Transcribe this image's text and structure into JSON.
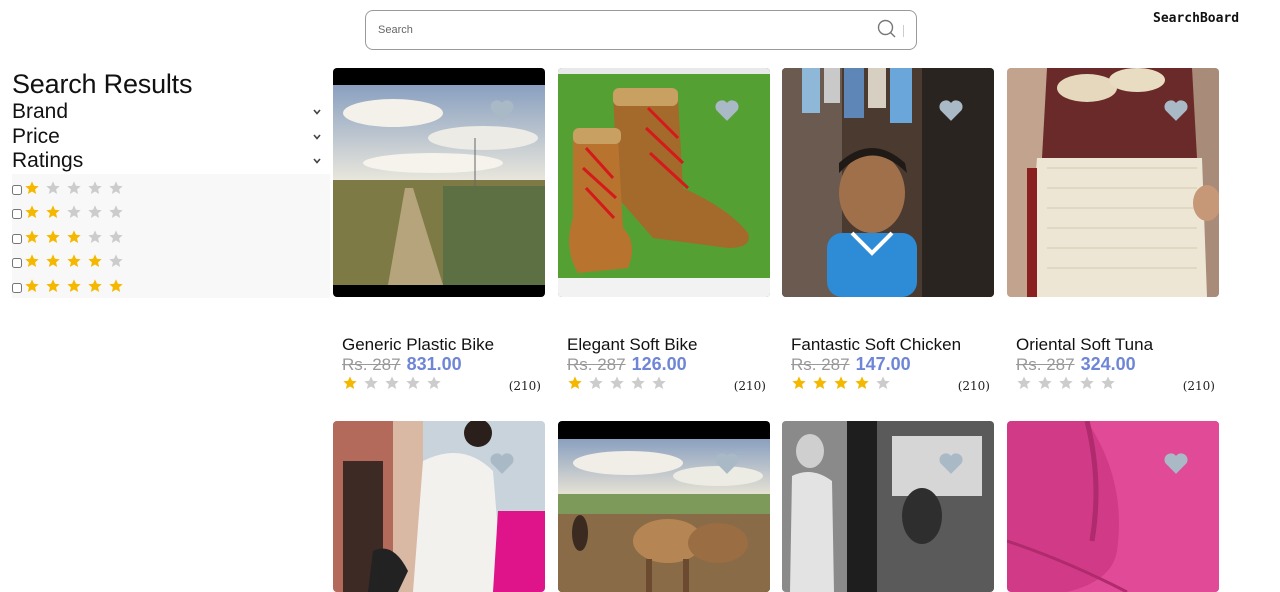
{
  "header": {
    "search_placeholder": "Search",
    "brand": "SearchBoard"
  },
  "sidebar": {
    "title": "Search Results",
    "filters": [
      {
        "label": "Brand"
      },
      {
        "label": "Price"
      },
      {
        "label": "Ratings"
      }
    ],
    "rating_options": [
      1,
      2,
      3,
      4,
      5
    ]
  },
  "colors": {
    "star_filled": "#f5b800",
    "star_empty": "#cccccc",
    "price_accent": "#6f86d6",
    "heart": "#aab9c6"
  },
  "products": [
    {
      "name": "Generic Plastic Bike",
      "old_price": "Rs. 287",
      "price": "831.00",
      "rating": 1,
      "count": "(210)"
    },
    {
      "name": "Elegant Soft Bike",
      "old_price": "Rs. 287",
      "price": "126.00",
      "rating": 1,
      "count": "(210)"
    },
    {
      "name": "Fantastic Soft Chicken",
      "old_price": "Rs. 287",
      "price": "147.00",
      "rating": 4,
      "count": "(210)"
    },
    {
      "name": "Oriental Soft Tuna",
      "old_price": "Rs. 287",
      "price": "324.00",
      "rating": 0,
      "count": "(210)"
    },
    {
      "name": "",
      "old_price": "",
      "price": "",
      "rating": 0,
      "count": ""
    },
    {
      "name": "",
      "old_price": "",
      "price": "",
      "rating": 0,
      "count": ""
    },
    {
      "name": "",
      "old_price": "",
      "price": "",
      "rating": 0,
      "count": ""
    },
    {
      "name": "",
      "old_price": "",
      "price": "",
      "rating": 0,
      "count": ""
    }
  ]
}
